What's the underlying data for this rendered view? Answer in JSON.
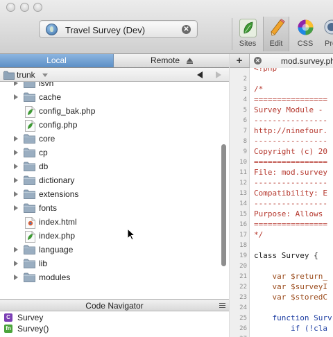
{
  "toolbar": {
    "site": {
      "name": "Travel Survey (Dev)",
      "icon": "globe-icon",
      "clear_icon": "clear-icon",
      "clear_glyph": "✕"
    },
    "buttons": [
      {
        "id": "sites",
        "label": "Sites",
        "icon": "leaf-icon"
      },
      {
        "id": "edit",
        "label": "Edit",
        "icon": "pencil-icon"
      },
      {
        "id": "css",
        "label": "CSS",
        "icon": "color-wheel-icon"
      },
      {
        "id": "preview",
        "label": "Pre",
        "icon": "preview-icon"
      }
    ]
  },
  "left_panel": {
    "tabs": {
      "local": "Local",
      "remote": "Remote"
    },
    "path": {
      "current": "trunk"
    },
    "tree": [
      {
        "name": "lsvn",
        "type": "folder"
      },
      {
        "name": "cache",
        "type": "folder"
      },
      {
        "name": "config_bak.php",
        "type": "php"
      },
      {
        "name": "config.php",
        "type": "php"
      },
      {
        "name": "core",
        "type": "folder"
      },
      {
        "name": "cp",
        "type": "folder"
      },
      {
        "name": "db",
        "type": "folder"
      },
      {
        "name": "dictionary",
        "type": "folder"
      },
      {
        "name": "extensions",
        "type": "folder"
      },
      {
        "name": "fonts",
        "type": "folder"
      },
      {
        "name": "index.html",
        "type": "html"
      },
      {
        "name": "index.php",
        "type": "php"
      },
      {
        "name": "language",
        "type": "folder"
      },
      {
        "name": "lib",
        "type": "folder"
      },
      {
        "name": "modules",
        "type": "folder"
      }
    ]
  },
  "code_navigator": {
    "title": "Code Navigator",
    "items": [
      {
        "badge": "C",
        "label": "Survey",
        "color": "#7b3fb4"
      },
      {
        "badge": "fn",
        "label": "Survey()",
        "color": "#4aa43a"
      }
    ]
  },
  "editor": {
    "tab_title": "mod.survey.ph",
    "tab_close_glyph": "✕",
    "new_tab_glyph": "+",
    "lines": [
      {
        "n": "",
        "text": "<?php",
        "cls": "c-comment"
      },
      {
        "n": "2",
        "text": "",
        "cls": "c-plain"
      },
      {
        "n": "3",
        "text": "/*",
        "cls": "c-comment"
      },
      {
        "n": "4",
        "text": "================",
        "cls": "c-comment"
      },
      {
        "n": "5",
        "text": "Survey Module - ",
        "cls": "c-comment"
      },
      {
        "n": "6",
        "text": "----------------",
        "cls": "c-comment"
      },
      {
        "n": "7",
        "text": "http://ninefour.",
        "cls": "c-comment"
      },
      {
        "n": "8",
        "text": "----------------",
        "cls": "c-comment"
      },
      {
        "n": "9",
        "text": "Copyright (c) 20",
        "cls": "c-comment"
      },
      {
        "n": "10",
        "text": "================",
        "cls": "c-comment"
      },
      {
        "n": "11",
        "text": "File: mod.survey",
        "cls": "c-comment"
      },
      {
        "n": "12",
        "text": "----------------",
        "cls": "c-comment"
      },
      {
        "n": "13",
        "text": "Compatibility: E",
        "cls": "c-comment"
      },
      {
        "n": "14",
        "text": "----------------",
        "cls": "c-comment"
      },
      {
        "n": "15",
        "text": "Purpose: Allows ",
        "cls": "c-comment"
      },
      {
        "n": "16",
        "text": "================",
        "cls": "c-comment"
      },
      {
        "n": "17",
        "text": "*/",
        "cls": "c-comment"
      },
      {
        "n": "18",
        "text": "",
        "cls": "c-plain"
      },
      {
        "n": "19",
        "text": "class Survey {",
        "cls": "c-plain"
      },
      {
        "n": "20",
        "text": "",
        "cls": "c-plain"
      },
      {
        "n": "21",
        "text": "    var $return_",
        "cls": "c-var"
      },
      {
        "n": "22",
        "text": "    var $surveyI",
        "cls": "c-var"
      },
      {
        "n": "23",
        "text": "    var $storedC",
        "cls": "c-var"
      },
      {
        "n": "24",
        "text": "",
        "cls": "c-plain"
      },
      {
        "n": "25",
        "text": "    function Surv",
        "cls": "c-key"
      },
      {
        "n": "26",
        "text": "        if (!cla",
        "cls": "c-key"
      },
      {
        "n": "27",
        "text": "",
        "cls": "c-plain"
      }
    ]
  }
}
